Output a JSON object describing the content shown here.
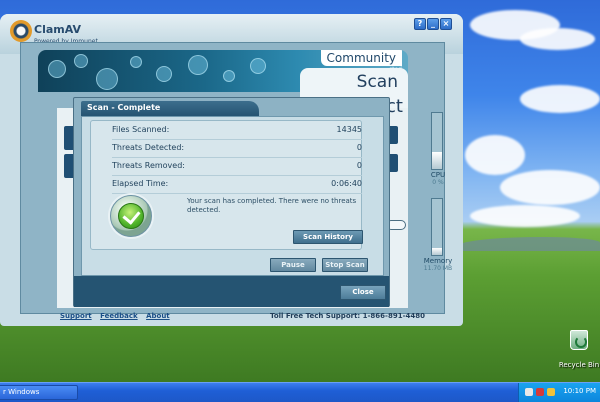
{
  "app": {
    "logo_text": "ClamAV",
    "logo_sub": "Powered by Immunet",
    "community_label": "Community",
    "protected_label": "cted",
    "scan_tab_title": "Scan",
    "right_partial_title": "ct",
    "controls": {
      "help": "?",
      "minimize": "_",
      "close": "×"
    }
  },
  "meters": {
    "cpu_label": "CPU",
    "cpu_value": "0 %",
    "cpu_fill": 0.3,
    "memory_label": "Memory",
    "memory_value": "11.70 MB",
    "memory_fill": 0.12
  },
  "dialog": {
    "title": "Scan - Complete",
    "rows": [
      {
        "label": "Files Scanned:",
        "value": "14345"
      },
      {
        "label": "Threats Detected:",
        "value": "0"
      },
      {
        "label": "Threats Removed:",
        "value": "0"
      },
      {
        "label": "Elapsed Time:",
        "value": "0:06:40"
      }
    ],
    "message": "Your scan has completed. There were no threats detected.",
    "scan_history_label": "Scan History",
    "pause_label": "Pause",
    "stop_scan_label": "Stop Scan",
    "close_label": "Close"
  },
  "footer": {
    "support": "Support",
    "feedback": "Feedback",
    "about": "About",
    "tollfree": "Toll Free Tech Support: 1-866-891-4480"
  },
  "desktop": {
    "recycle_bin": "Recycle Bin"
  },
  "taskbar": {
    "task_label": "r Windows",
    "clock": "10:10 PM"
  }
}
